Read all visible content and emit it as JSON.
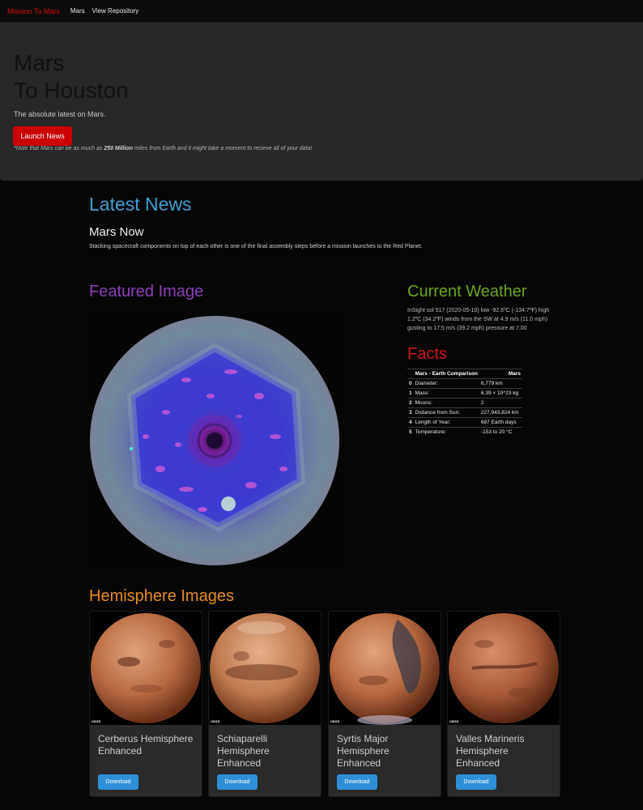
{
  "navbar": {
    "brand": "Mission To Mars",
    "links": [
      "Mars",
      "View Repository"
    ]
  },
  "jumbotron": {
    "title_line1": "Mars",
    "title_line2": "To Houston",
    "lead": "The absolute latest on Mars.",
    "button_label": "Launch News",
    "note_before": "*Note that Mars can be as much as ",
    "note_bold": "250 Million",
    "note_after": " miles from Earth and it might take a moment to recieve all of your data!"
  },
  "news": {
    "section_title": "Latest News",
    "headline": "Mars Now",
    "paragraph": "Stacking spacecraft components on top of each other is one of the final assembly steps before a mission launches to the Red Planet."
  },
  "featured": {
    "section_title": "Featured Image"
  },
  "weather": {
    "section_title": "Current Weather",
    "text": "InSight sol 517 (2020-05-10) low -92.6ºC (-134.7ºF) high 1.2ºC (34.2ºF) winds from the SW at 4.9 m/s (11.0 mph) gusting to 17.5 m/s (39.2 mph) pressure at 7.00"
  },
  "facts": {
    "section_title": "Facts",
    "headers": [
      "",
      "Mars - Earth Comparison",
      "Mars"
    ],
    "rows": [
      [
        "0",
        "Diameter:",
        "6,779 km"
      ],
      [
        "1",
        "Mass:",
        "6.39 × 10^23 kg"
      ],
      [
        "2",
        "Moons:",
        "2"
      ],
      [
        "3",
        "Distance from Sun:",
        "227,943,824 km"
      ],
      [
        "4",
        "Length of Year:",
        "687 Earth days"
      ],
      [
        "5",
        "Temperature:",
        "-153 to 20 °C"
      ]
    ]
  },
  "hemispheres": {
    "section_title": "Hemisphere Images",
    "download_label": "Download",
    "logo_text": "USGS",
    "items": [
      {
        "name": "Cerberus Hemisphere Enhanced"
      },
      {
        "name": "Schiaparelli Hemisphere Enhanced"
      },
      {
        "name": "Syrtis Major Hemisphere Enhanced"
      },
      {
        "name": "Valles Marineris Hemisphere Enhanced"
      }
    ]
  },
  "colors": {
    "brand": "#d60d0d",
    "news_title": "#3f9fd4",
    "featured_title": "#8e3db8",
    "weather_title": "#6aa61e",
    "facts_title": "#cc1515",
    "hemisphere_title": "#e98b1c",
    "launch_button": "#cc0000",
    "download_button": "#2e8fd6"
  }
}
